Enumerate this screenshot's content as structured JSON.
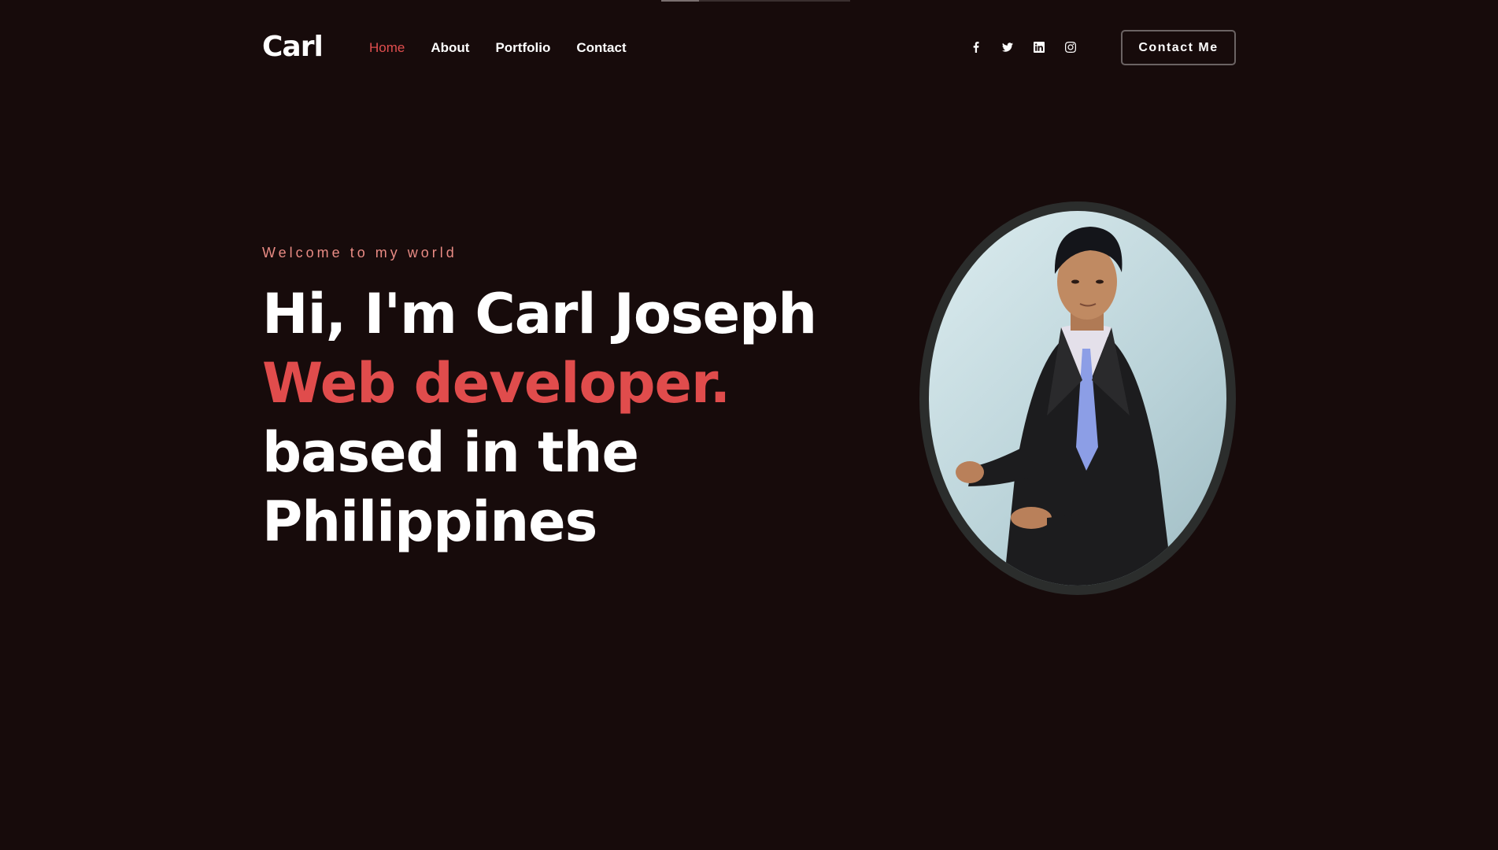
{
  "scroll_indicator": {
    "progress": 0.2
  },
  "header": {
    "logo": "Carl",
    "nav": [
      {
        "label": "Home",
        "active": true
      },
      {
        "label": "About",
        "active": false
      },
      {
        "label": "Portfolio",
        "active": false
      },
      {
        "label": "Contact",
        "active": false
      }
    ],
    "socials": [
      "facebook-icon",
      "twitter-icon",
      "linkedin-icon",
      "instagram-icon"
    ],
    "cta_label": "Contact Me"
  },
  "hero": {
    "eyebrow": "Welcome to my world",
    "title_part1": "Hi, I'm Carl Joseph ",
    "title_accent": "Web developer.",
    "title_part2": " based in the Philippines"
  },
  "colors": {
    "background": "#170b0b",
    "accent": "#e04c4c",
    "eyebrow": "#e98b84",
    "text": "#ffffff"
  }
}
